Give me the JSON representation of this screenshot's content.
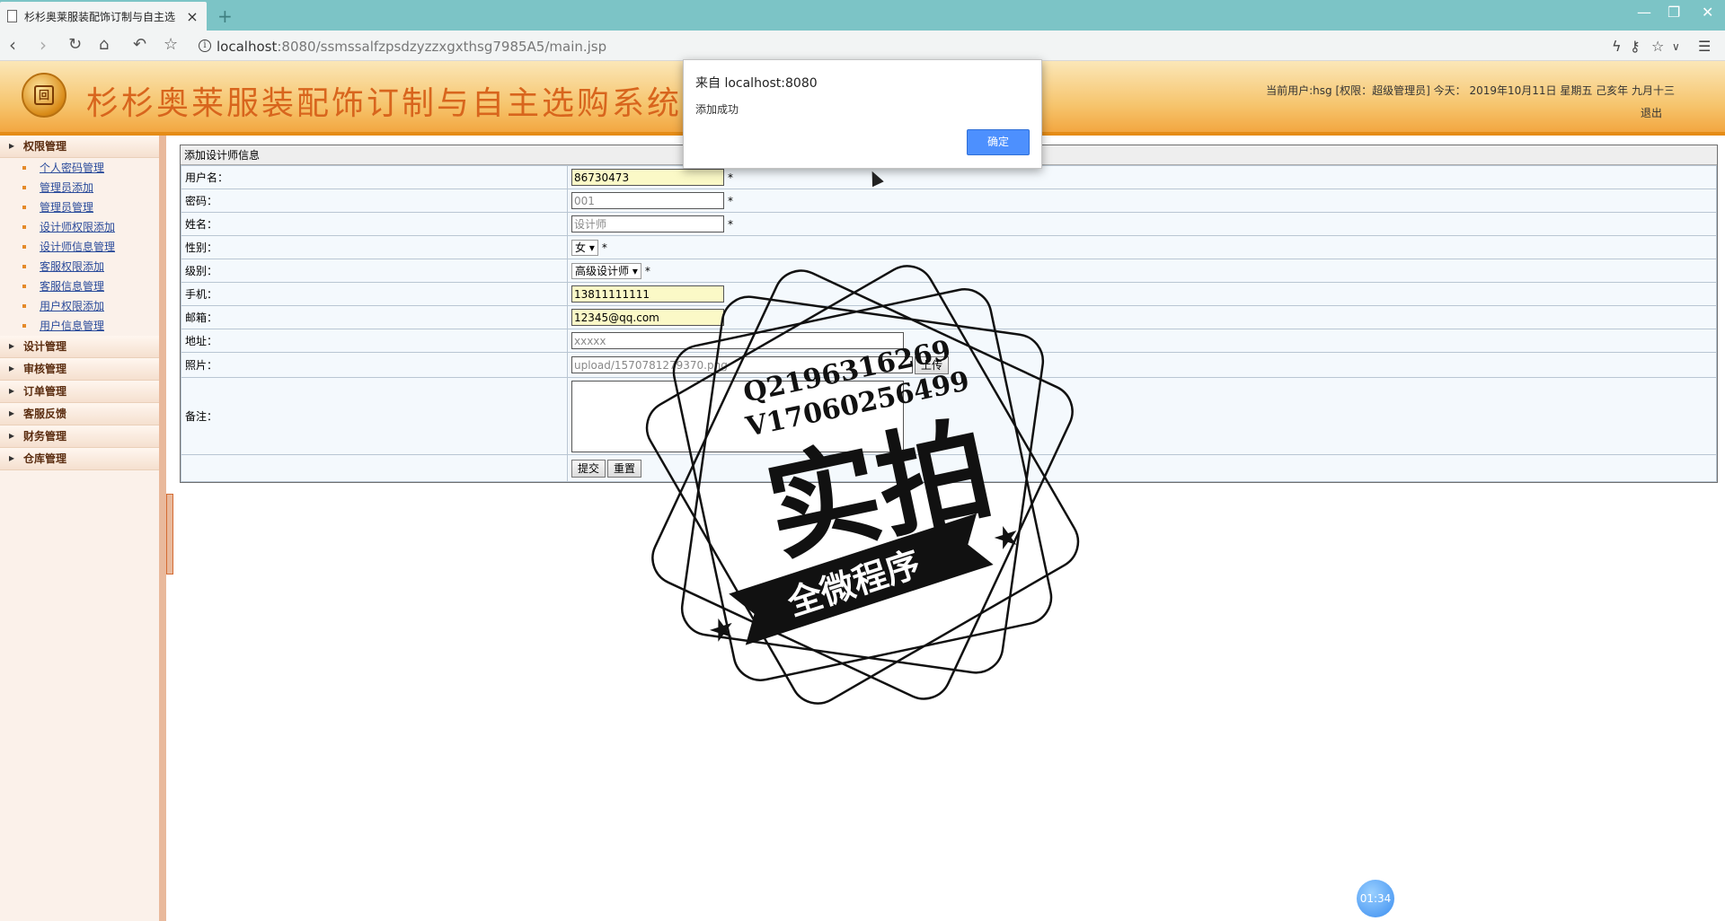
{
  "browser": {
    "tab_title": "杉杉奥莱服装配饰订制与自主选",
    "tab_close": "×",
    "new_tab": "+",
    "url_host": "localhost",
    "url_rest": ":8080/ssmssalfzpsdzyzzxgxthsg7985A5/main.jsp",
    "icons": [
      "back-icon",
      "forward-icon",
      "reload-icon",
      "home-icon",
      "undo-icon",
      "bookmark-star-icon",
      "info-icon",
      "lightning-icon",
      "key-icon",
      "star-icon",
      "chevron-down-icon",
      "menu-icon"
    ],
    "window_controls": [
      "—",
      "❐",
      "✕"
    ]
  },
  "header": {
    "site_title": "杉杉奥莱服装配饰订制与自主选购系统",
    "user_info": "当前用户:hsg [权限：超级管理员] 今天： 2019年10月11日 星期五 己亥年 九月十三",
    "logout": "退出",
    "brand_color": "#d8651d"
  },
  "sidebar": {
    "groups": [
      {
        "label": "权限管理",
        "items": [
          "个人密码管理",
          "管理员添加",
          "管理员管理",
          "设计师权限添加",
          "设计师信息管理",
          "客服权限添加",
          "客服信息管理",
          "用户权限添加",
          "用户信息管理"
        ]
      },
      {
        "label": "设计管理"
      },
      {
        "label": "审核管理"
      },
      {
        "label": "订单管理"
      },
      {
        "label": "客服反馈"
      },
      {
        "label": "财务管理"
      },
      {
        "label": "仓库管理"
      }
    ]
  },
  "form": {
    "caption": "添加设计师信息",
    "required_mark": "*",
    "fields": {
      "username": {
        "label": "用户名：",
        "value": "86730473"
      },
      "password": {
        "label": "密码：",
        "value": "001"
      },
      "name": {
        "label": "姓名：",
        "value": "设计师"
      },
      "gender": {
        "label": "性别：",
        "value": "女"
      },
      "level": {
        "label": "级别：",
        "value": "高级设计师"
      },
      "phone": {
        "label": "手机：",
        "value": "13811111111"
      },
      "email": {
        "label": "邮箱：",
        "value": "12345@qq.com"
      },
      "address": {
        "label": "地址：",
        "value": "xxxxx"
      },
      "photo": {
        "label": "照片：",
        "value": "upload/1570781279370.png",
        "upload_button": "上传"
      },
      "remark": {
        "label": "备注：",
        "value": ""
      }
    },
    "submit": "提交",
    "reset": "重置"
  },
  "dialog": {
    "from": "来自 localhost:8080",
    "message": "添加成功",
    "ok": "确定"
  },
  "watermark": {
    "line1": "Q2196316269",
    "line2": "V17060256499",
    "big": "实拍",
    "banner": "全微程序"
  },
  "timer": "01:34"
}
